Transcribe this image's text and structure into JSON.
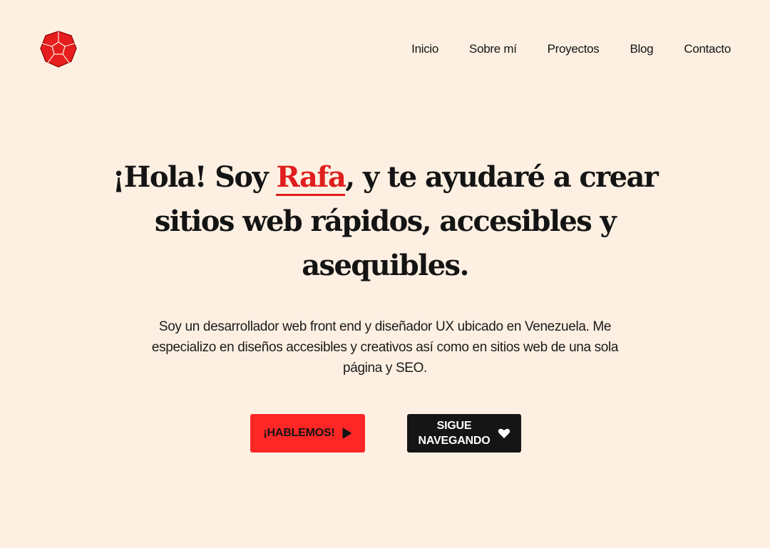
{
  "header": {
    "logo_icon": "dodecahedron-logo-icon",
    "nav": [
      {
        "label": "Inicio"
      },
      {
        "label": "Sobre mí"
      },
      {
        "label": "Proyectos"
      },
      {
        "label": "Blog"
      },
      {
        "label": "Contacto"
      }
    ]
  },
  "hero": {
    "title_before": "¡Hola! Soy ",
    "title_name": "Rafa",
    "title_after": ", y te ayudaré a crear sitios web rápidos, accesibles y asequibles.",
    "description": "Soy un desarrollador web front end y diseñador UX ubicado en Venezuela. Me\nespecializo en diseños accesibles y creativos así como en sitios web de una sola\npágina  y SEO.",
    "cta_primary": {
      "label": "¡HABLEMOS!",
      "icon": "play-icon"
    },
    "cta_secondary": {
      "label_line1": "SIGUE",
      "label_line2": "NAVEGANDO",
      "icon": "heart-icon"
    }
  },
  "colors": {
    "background": "#fdf0e2",
    "accent": "#ff2626",
    "accent_text": "#e01e1e",
    "dark": "#151515"
  }
}
